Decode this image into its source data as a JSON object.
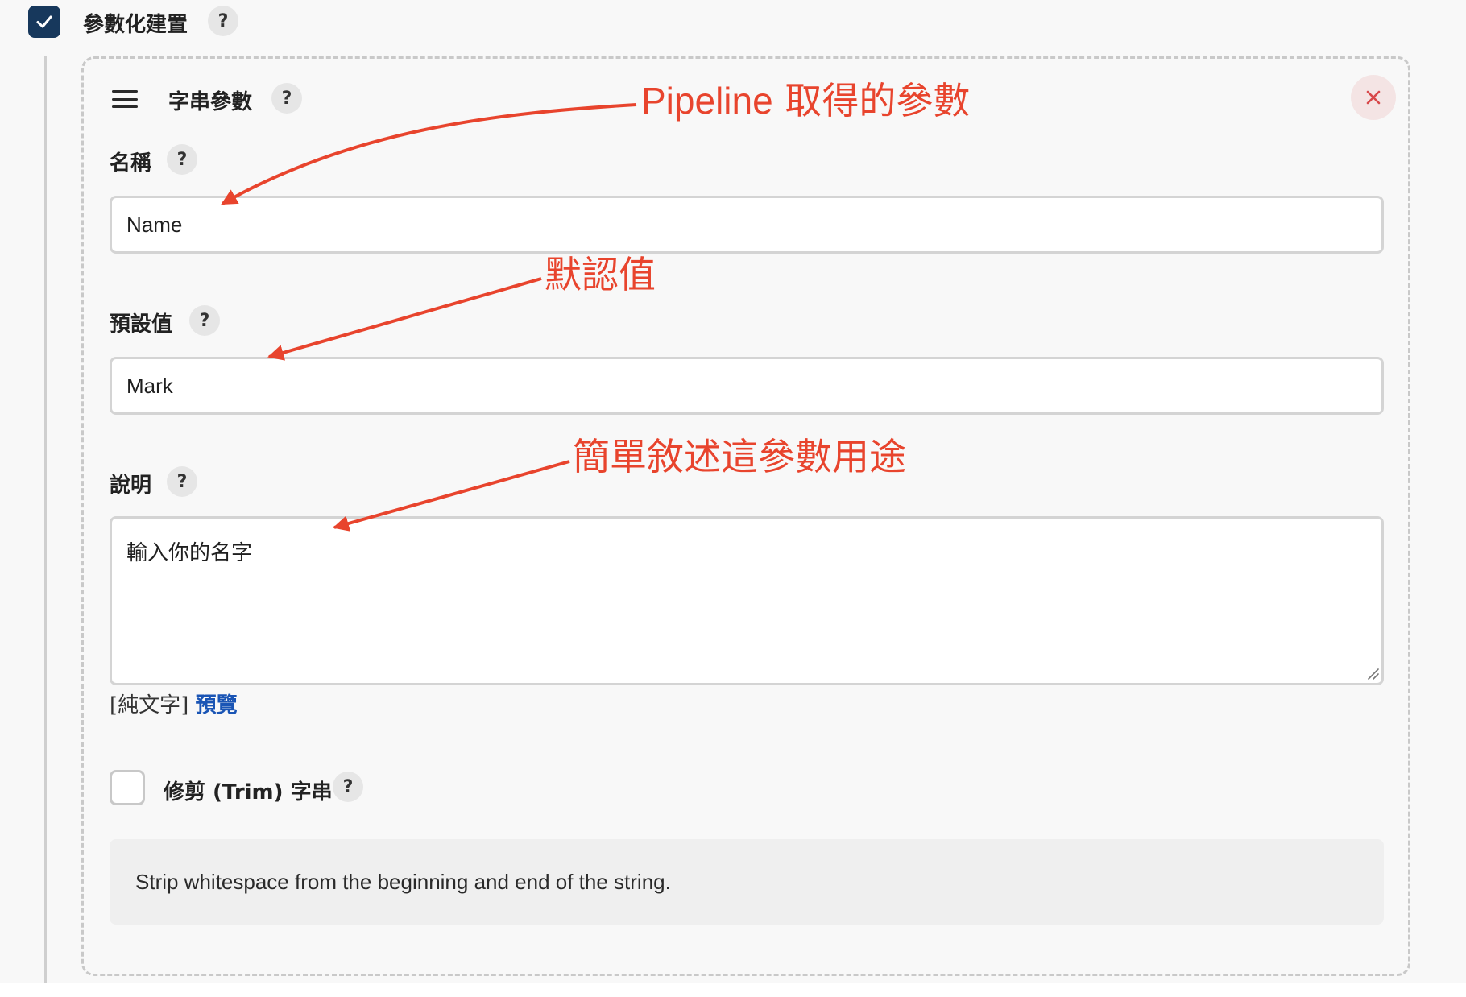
{
  "header": {
    "parameterized_label": "參數化建置",
    "parameterized_checked": true,
    "help": "?"
  },
  "param_block": {
    "type_label": "字串參數",
    "help": "?",
    "close_label": "×",
    "name": {
      "label": "名稱",
      "help": "?",
      "value": "Name"
    },
    "default_value": {
      "label": "預設值",
      "help": "?",
      "value": "Mark"
    },
    "description": {
      "label": "說明",
      "help": "?",
      "value": "輸入你的名字",
      "format_plain": "[純文字]",
      "format_preview": "預覽"
    },
    "trim": {
      "label": "修剪 (Trim) 字串",
      "help": "?",
      "checked": false
    },
    "trim_help_text": "Strip whitespace from the beginning and end of the string."
  },
  "annotations": {
    "name_note_latin": "Pipeline",
    "name_note_cjk": "取得的參數",
    "default_note": "默認值",
    "description_note": "簡單敘述這參數用途"
  },
  "colors": {
    "checkbox_checked": "#17385c",
    "annotation_red": "#e8442d",
    "link_blue": "#1a55b5"
  }
}
